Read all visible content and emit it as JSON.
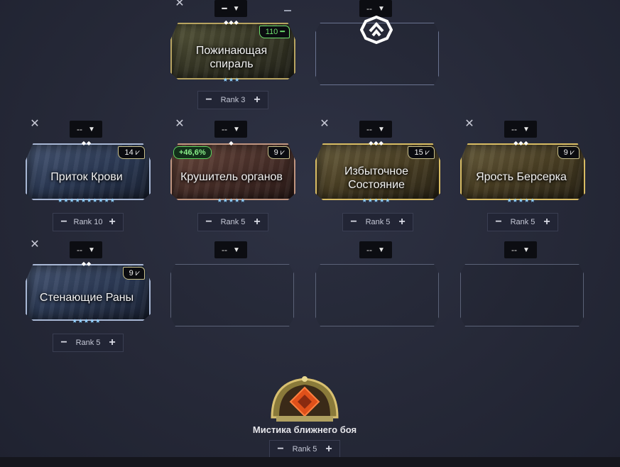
{
  "placeholder": "--",
  "exilus": {
    "polarity_symbol": "━",
    "name_line1": "Пожинающая",
    "name_line2": "спираль",
    "drain": "110",
    "rank": "Rank 3"
  },
  "aura": {
    "polarity": "--",
    "icon": "aura-icon"
  },
  "mods": [
    {
      "name": "Приток Крови",
      "drain": "14",
      "rank": "Rank 10",
      "polarity": "--",
      "bonus": ""
    },
    {
      "name": "Крушитель органов",
      "drain": "9",
      "rank": "Rank 5",
      "polarity": "--",
      "bonus": "+46,6%"
    },
    {
      "name_line1": "Избыточное",
      "name_line2": "Состояние",
      "drain": "15",
      "rank": "Rank 5",
      "polarity": "--",
      "bonus": ""
    },
    {
      "name": "Ярость Берсерка",
      "drain": "9",
      "rank": "Rank 5",
      "polarity": "--",
      "bonus": ""
    },
    {
      "name": "Стенающие Раны",
      "drain": "9",
      "rank": "Rank 5",
      "polarity": "--",
      "bonus": ""
    }
  ],
  "empty_slots": [
    {
      "polarity": "--"
    },
    {
      "polarity": "--"
    },
    {
      "polarity": "--"
    }
  ],
  "stance": {
    "name": "Мистика ближнего боя",
    "rank": "Rank 5"
  },
  "colors": {
    "bonus_green": "#6ee06e",
    "star_blue": "#8fd1ff",
    "background": "#262938"
  }
}
